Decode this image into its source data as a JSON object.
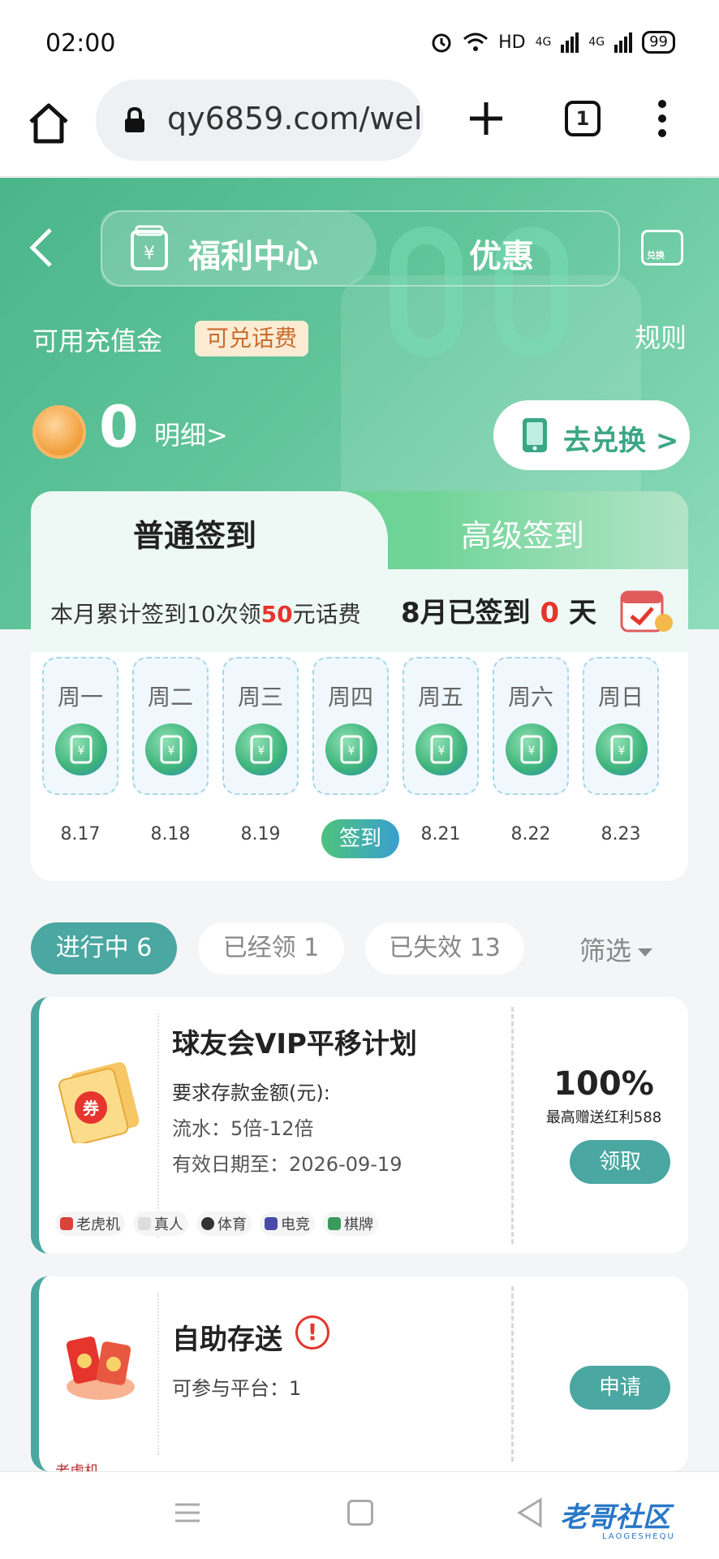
{
  "status_bar": {
    "time": "02:00",
    "network": "HD",
    "signal_1": "4G",
    "signal_2": "4G",
    "battery": "99"
  },
  "browser": {
    "url": "qy6859.com/wel",
    "tab_count": "1"
  },
  "header": {
    "tab_welfare": "福利中心",
    "tab_offers": "优惠",
    "exchange_icon_label": "兑换",
    "credit_label": "可用充值金",
    "credit_badge": "可兑话费",
    "rules": "规则",
    "balance": "0",
    "detail": "明细>",
    "go_exchange": "去兑换 >"
  },
  "signin": {
    "tab_normal": "普通签到",
    "tab_advanced": "高级签到",
    "banner_prefix": "本月累计签到10次领",
    "banner_amount": "50",
    "banner_suffix": "元话费",
    "status_prefix": "8月已签到 ",
    "status_count": "0",
    "status_suffix": " 天",
    "days": [
      {
        "label": "周一",
        "date": "8.17"
      },
      {
        "label": "周二",
        "date": "8.18"
      },
      {
        "label": "周三",
        "date": "8.19"
      },
      {
        "label": "周四",
        "date": "签到"
      },
      {
        "label": "周五",
        "date": "8.21"
      },
      {
        "label": "周六",
        "date": "8.22"
      },
      {
        "label": "周日",
        "date": "8.23"
      }
    ]
  },
  "filters": {
    "active": "进行中  6",
    "received": "已经领  1",
    "expired": "已失效  13",
    "sort": "筛选"
  },
  "promos": [
    {
      "title": "球友会VIP平移计划",
      "requirement": "要求存款金额(元):",
      "turnover": "流水：5倍-12倍",
      "expiry": "有效日期至：2026-09-19",
      "percent": "100%",
      "max_bonus": "最高赠送红利588",
      "button": "领取",
      "ticket_label": "券",
      "tags": [
        "老虎机",
        "真人",
        "体育",
        "电竞",
        "棋牌"
      ]
    },
    {
      "title": "自助存送",
      "alert": "!",
      "platforms": "可参与平台：1",
      "button": "申请",
      "tag": "老虎机"
    }
  ],
  "watermark": {
    "text": "老哥社区",
    "sub": "LAOGESHEQU"
  },
  "colors": {
    "accent": "#4aa7a1",
    "hero_green": "#4bb58a",
    "highlight_red": "#e5352d"
  }
}
